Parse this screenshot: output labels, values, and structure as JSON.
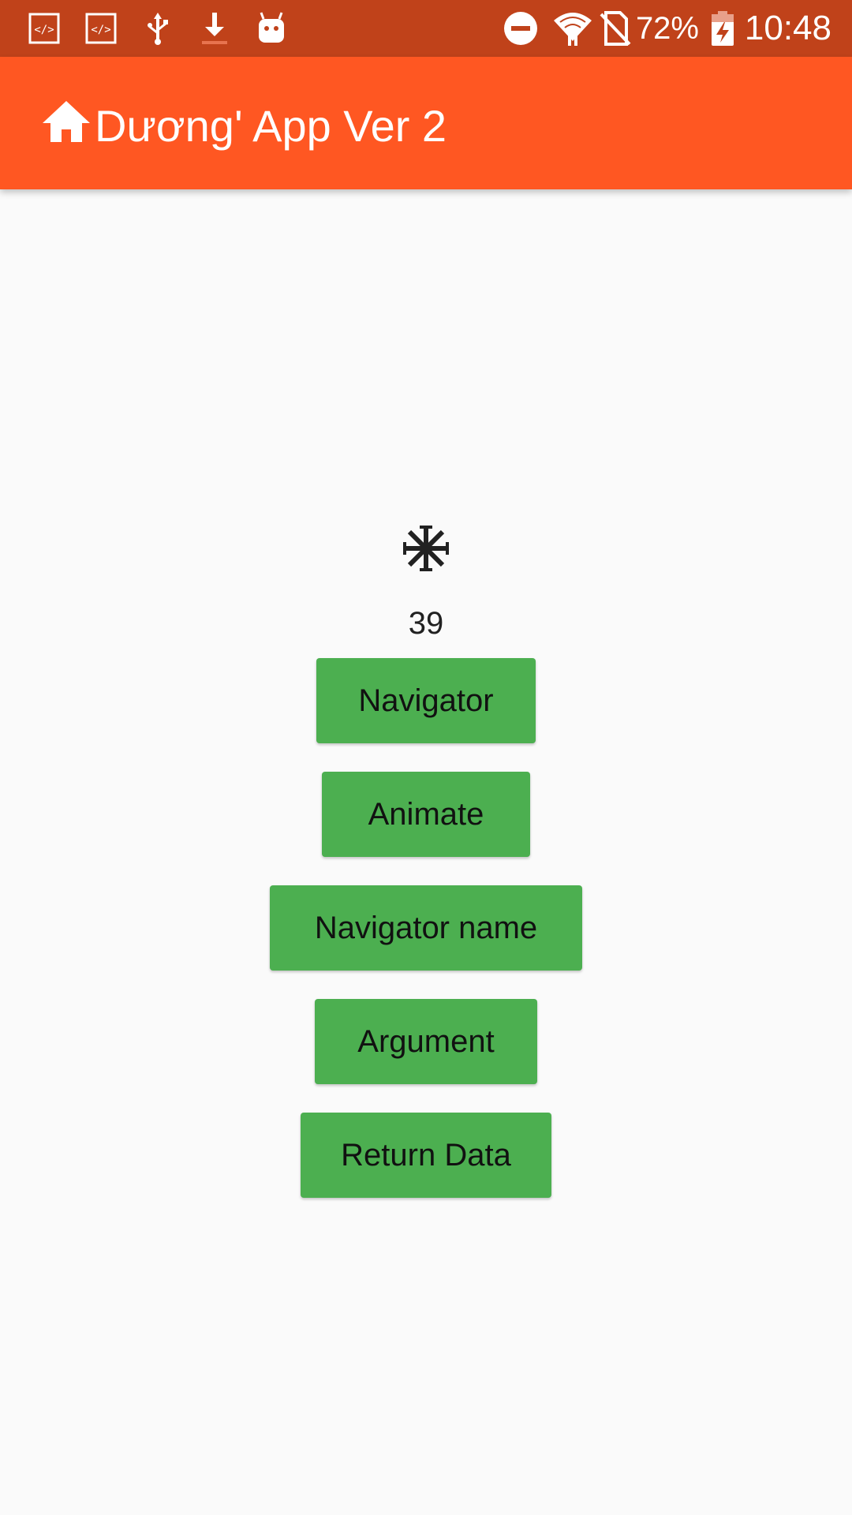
{
  "status_bar": {
    "left_icons": [
      "code-icon",
      "code-icon",
      "usb-icon",
      "download-icon",
      "android-icon"
    ],
    "right_icons": [
      "do-not-disturb-icon",
      "wifi-icon",
      "no-sim-icon",
      "battery-charging-icon"
    ],
    "battery_percent": "72%",
    "time": "10:48",
    "background_color": "#c0421a"
  },
  "app_bar": {
    "icon": "home-icon",
    "title": "Dương' App Ver 2",
    "background_color": "#ff5722"
  },
  "main": {
    "spinner_icon": "snowflake-icon",
    "counter": "39",
    "buttons": [
      {
        "label": "Navigator"
      },
      {
        "label": "Animate"
      },
      {
        "label": "Navigator name"
      },
      {
        "label": "Argument"
      },
      {
        "label": "Return Data"
      }
    ],
    "button_color": "#4caf50"
  }
}
